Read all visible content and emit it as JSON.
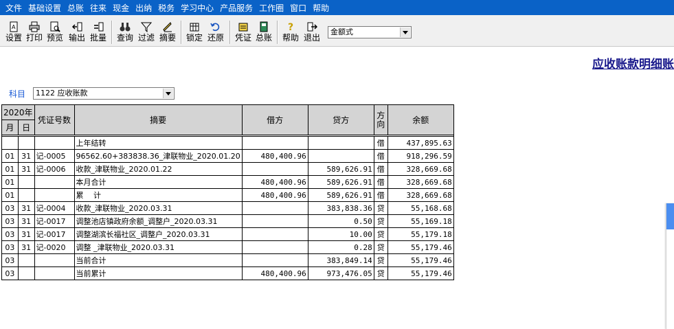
{
  "menu": [
    "文件",
    "基础设置",
    "总账",
    "往来",
    "现金",
    "出纳",
    "税务",
    "学习中心",
    "产品服务",
    "工作圈",
    "窗口",
    "帮助"
  ],
  "toolbar": {
    "buttons": [
      {
        "label": "设置",
        "icon": "settings-doc-icon"
      },
      {
        "label": "打印",
        "icon": "printer-icon"
      },
      {
        "label": "预览",
        "icon": "preview-icon"
      },
      {
        "label": "输出",
        "icon": "export-icon"
      },
      {
        "label": "批量",
        "icon": "batch-icon"
      },
      {
        "label": "查询",
        "icon": "binoculars-icon"
      },
      {
        "label": "过滤",
        "icon": "filter-icon"
      },
      {
        "label": "摘要",
        "icon": "summary-icon"
      },
      {
        "label": "锁定",
        "icon": "lock-icon"
      },
      {
        "label": "还原",
        "icon": "restore-icon"
      },
      {
        "label": "凭证",
        "icon": "voucher-icon"
      },
      {
        "label": "总账",
        "icon": "ledger-book-icon"
      },
      {
        "label": "帮助",
        "icon": "help-icon"
      },
      {
        "label": "退出",
        "icon": "exit-icon"
      }
    ],
    "format_select": "金额式"
  },
  "report_title": "应收账款明细账",
  "subject": {
    "label": "科目",
    "value": "1122 应收账款"
  },
  "table": {
    "year_header": "2020年",
    "month_header": "月",
    "day_header": "日",
    "voucher_header": "凭证号数",
    "summary_header": "摘要",
    "debit_header": "借方",
    "credit_header": "贷方",
    "direction_header": "方向",
    "balance_header": "余额",
    "rows": [
      {
        "m": "",
        "d": "",
        "v": "",
        "s": "上年结转",
        "dr": "",
        "cr": "",
        "dir": "借",
        "bal": "437,895.63"
      },
      {
        "m": "01",
        "d": "31",
        "v": "记-0005",
        "s": "96562.60+383838.36_津联物业_2020.01.20",
        "dr": "480,400.96",
        "cr": "",
        "dir": "借",
        "bal": "918,296.59"
      },
      {
        "m": "01",
        "d": "31",
        "v": "记-0006",
        "s": "收款_津联物业_2020.01.22",
        "dr": "",
        "cr": "589,626.91",
        "dir": "借",
        "bal": "328,669.68"
      },
      {
        "m": "01",
        "d": "",
        "v": "",
        "s": "本月合计",
        "dr": "480,400.96",
        "cr": "589,626.91",
        "dir": "借",
        "bal": "328,669.68"
      },
      {
        "m": "01",
        "d": "",
        "v": "",
        "s": "累　 计",
        "dr": "480,400.96",
        "cr": "589,626.91",
        "dir": "借",
        "bal": "328,669.68"
      },
      {
        "m": "03",
        "d": "31",
        "v": "记-0004",
        "s": "收款_津联物业_2020.03.31",
        "dr": "",
        "cr": "383,838.36",
        "dir": "贷",
        "bal": "55,168.68"
      },
      {
        "m": "03",
        "d": "31",
        "v": "记-0017",
        "s": "调整池店镇政府余额_调整户_2020.03.31",
        "dr": "",
        "cr": "0.50",
        "dir": "贷",
        "bal": "55,169.18"
      },
      {
        "m": "03",
        "d": "31",
        "v": "记-0017",
        "s": "调整湖滨长福社区_调整户_2020.03.31",
        "dr": "",
        "cr": "10.00",
        "dir": "贷",
        "bal": "55,179.18"
      },
      {
        "m": "03",
        "d": "31",
        "v": "记-0020",
        "s": "调整 _津联物业_2020.03.31",
        "dr": "",
        "cr": "0.28",
        "dir": "贷",
        "bal": "55,179.46"
      },
      {
        "m": "03",
        "d": "",
        "v": "",
        "s": "当前合计",
        "dr": "",
        "cr": "383,849.14",
        "dir": "贷",
        "bal": "55,179.46"
      },
      {
        "m": "03",
        "d": "",
        "v": "",
        "s": "当前累计",
        "dr": "480,400.96",
        "cr": "973,476.05",
        "dir": "贷",
        "bal": "55,179.46"
      }
    ]
  }
}
